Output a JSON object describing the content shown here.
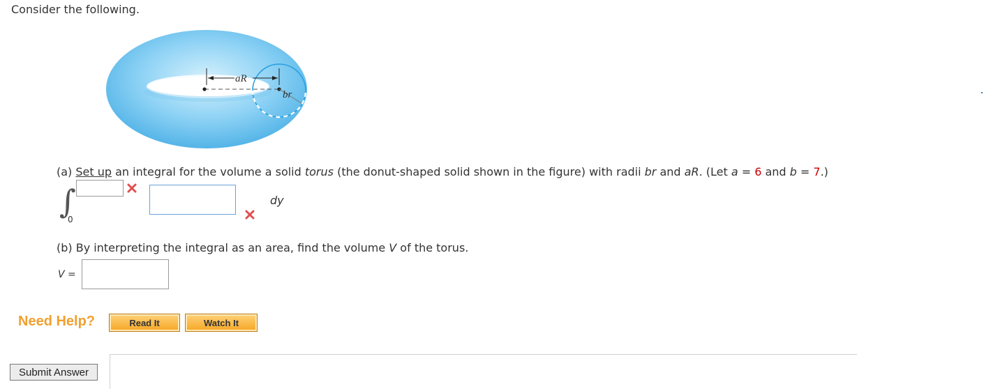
{
  "intro": "Consider the following.",
  "figure": {
    "label_aR": "aR",
    "label_br": "br",
    "colors": {
      "torus_light": "#bfe8fb",
      "torus_dark": "#56b8ea",
      "circle": "#2a9fe0"
    }
  },
  "part_a": {
    "prefix": "(a) ",
    "underlined": "Set up",
    "text1": " an integral for the volume a solid ",
    "torus_word": "torus",
    "text2": " (the donut-shaped solid shown in the figure) with radii ",
    "br": "br",
    "and": " and ",
    "aR": "aR",
    "text3": ". (Let ",
    "a_var": "a",
    "eq1": " = ",
    "a_val": "6",
    "and2": " and ",
    "b_var": "b",
    "eq2": " = ",
    "b_val": "7",
    "close": ".)",
    "integral_symbol": "∫",
    "lower_limit": "0",
    "upper_limit_value": "",
    "integrand_value": "",
    "differential": "dy",
    "status_upper": "incorrect",
    "status_integrand": "incorrect"
  },
  "part_b": {
    "text1": "(b) By interpreting the integral as an area, find the volume ",
    "v_var": "V",
    "text2": " of the torus.",
    "v_label": "V",
    "v_eq": " =",
    "answer_value": ""
  },
  "help": {
    "need_help": "Need Help?",
    "read_it": "Read It",
    "watch_it": "Watch It"
  },
  "submit_label": "Submit Answer",
  "colors": {
    "error_red": "#e05050",
    "help_orange": "#f0a030",
    "value_red": "#cc0000"
  }
}
